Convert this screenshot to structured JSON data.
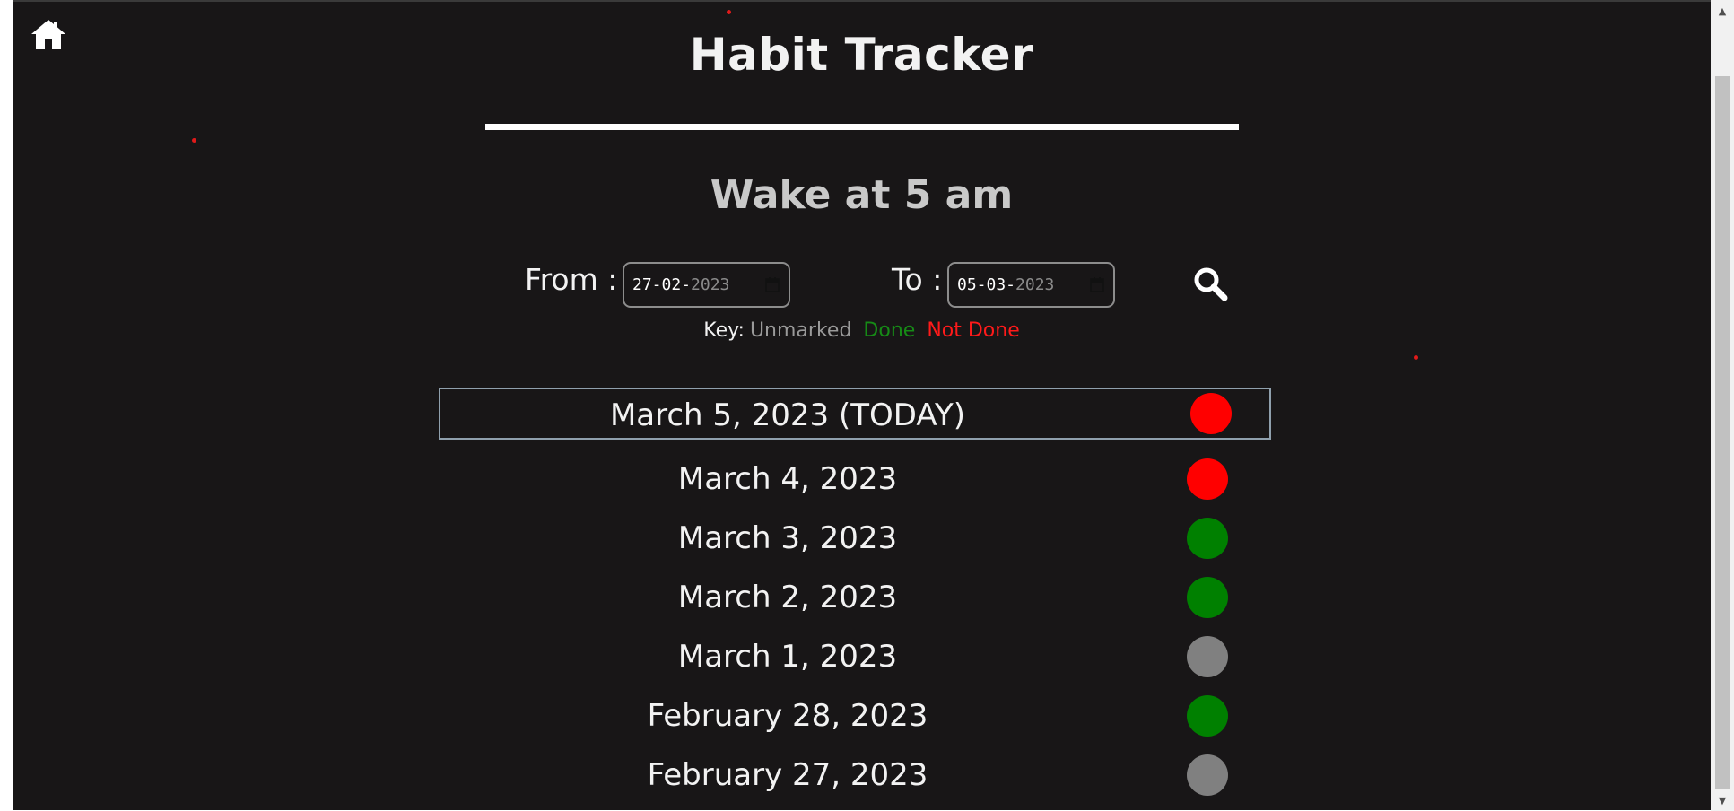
{
  "page": {
    "title": "Habit Tracker",
    "habit_name": "Wake at 5 am"
  },
  "range": {
    "from_label": "From :",
    "to_label": "To :",
    "from_day_month": "27-02-",
    "from_year": "2023",
    "to_day_month": "05-03-",
    "to_year": "2023"
  },
  "key": {
    "label": "Key:",
    "unmarked": "Unmarked",
    "done": "Done",
    "not_done": "Not Done"
  },
  "colors": {
    "unmarked": "#808080",
    "done": "#008000",
    "not_done": "#ff0000"
  },
  "icons": {
    "home": "home-icon",
    "search": "search-icon",
    "calendar": "calendar-icon"
  },
  "days": [
    {
      "label": "March 5, 2023 (TODAY)",
      "status": "not_done"
    },
    {
      "label": "March 4, 2023",
      "status": "not_done"
    },
    {
      "label": "March 3, 2023",
      "status": "done"
    },
    {
      "label": "March 2, 2023",
      "status": "done"
    },
    {
      "label": "March 1, 2023",
      "status": "unmarked"
    },
    {
      "label": "February 28, 2023",
      "status": "done"
    },
    {
      "label": "February 27, 2023",
      "status": "unmarked"
    }
  ]
}
